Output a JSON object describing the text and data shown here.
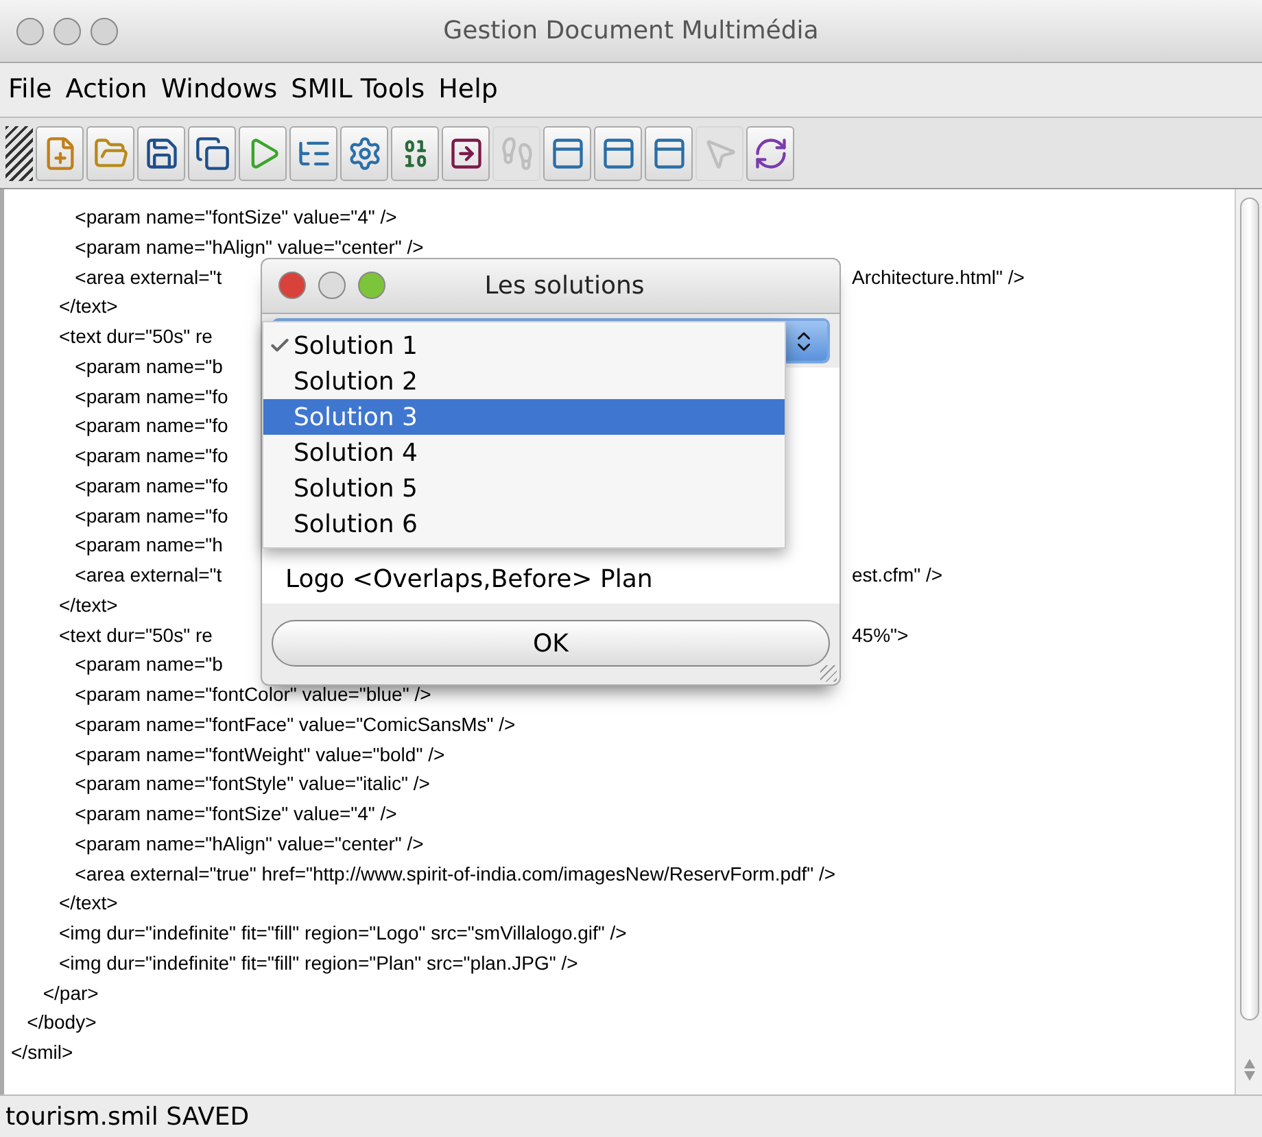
{
  "window": {
    "title": "Gestion Document Multimédia"
  },
  "menu": [
    "File",
    "Action",
    "Windows",
    "SMIL Tools",
    "Help"
  ],
  "toolbar": [
    {
      "kind": "new",
      "disabled": false
    },
    {
      "kind": "open",
      "disabled": false
    },
    {
      "kind": "save",
      "disabled": false
    },
    {
      "kind": "saveall",
      "disabled": false
    },
    {
      "kind": "play",
      "disabled": false
    },
    {
      "kind": "tree",
      "disabled": false
    },
    {
      "kind": "gear",
      "disabled": false
    },
    {
      "kind": "binary",
      "disabled": false
    },
    {
      "kind": "export",
      "disabled": false
    },
    {
      "kind": "run",
      "disabled": true
    },
    {
      "kind": "panel",
      "disabled": false
    },
    {
      "kind": "panel",
      "disabled": false
    },
    {
      "kind": "panel",
      "disabled": false
    },
    {
      "kind": "cursor",
      "disabled": true
    },
    {
      "kind": "refresh",
      "disabled": false
    }
  ],
  "editor": {
    "lines": [
      {
        "left": "            <param name=\"fontSize\" value=\"4\" />"
      },
      {
        "left": "            <param name=\"hAlign\" value=\"center\" />"
      },
      {
        "left": "            <area external=\"t",
        "right": "Architecture.html\" />"
      },
      {
        "left": "         </text>"
      },
      {
        "left": "         <text dur=\"50s\" re"
      },
      {
        "left": "            <param name=\"b"
      },
      {
        "left": "            <param name=\"fo"
      },
      {
        "left": "            <param name=\"fo"
      },
      {
        "left": "            <param name=\"fo"
      },
      {
        "left": "            <param name=\"fo"
      },
      {
        "left": "            <param name=\"fo"
      },
      {
        "left": "            <param name=\"h"
      },
      {
        "left": "            <area external=\"t",
        "right": "est.cfm\" />"
      },
      {
        "left": "         </text>"
      },
      {
        "left": "         <text dur=\"50s\" re",
        "right": "45%\">"
      },
      {
        "left": "            <param name=\"b"
      },
      {
        "left": "            <param name=\"fontColor\" value=\"blue\" />"
      },
      {
        "left": "            <param name=\"fontFace\" value=\"ComicSansMs\" />"
      },
      {
        "left": "            <param name=\"fontWeight\" value=\"bold\" />"
      },
      {
        "left": "            <param name=\"fontStyle\" value=\"italic\" />"
      },
      {
        "left": "            <param name=\"fontSize\" value=\"4\" />"
      },
      {
        "left": "            <param name=\"hAlign\" value=\"center\" />"
      },
      {
        "left": "            <area external=\"true\" href=\"http://www.spirit-of-india.com/imagesNew/ReservForm.pdf\" />"
      },
      {
        "left": "         </text>"
      },
      {
        "left": "         <img dur=\"indefinite\" fit=\"fill\" region=\"Logo\" src=\"smVillalogo.gif\" />"
      },
      {
        "left": "         <img dur=\"indefinite\" fit=\"fill\" region=\"Plan\" src=\"plan.JPG\" />"
      },
      {
        "left": "      </par>"
      },
      {
        "left": "   </body>"
      },
      {
        "left": "</smil>"
      }
    ]
  },
  "dialog": {
    "title": "Les solutions",
    "options": [
      {
        "label": "Solution 1",
        "checked": true,
        "selected": false
      },
      {
        "label": "Solution 2",
        "checked": false,
        "selected": false
      },
      {
        "label": "Solution 3",
        "checked": false,
        "selected": true
      },
      {
        "label": "Solution 4",
        "checked": false,
        "selected": false
      },
      {
        "label": "Solution 5",
        "checked": false,
        "selected": false
      },
      {
        "label": "Solution 6",
        "checked": false,
        "selected": false
      }
    ],
    "result": "Logo <Overlaps,Before> Plan",
    "button": "OK"
  },
  "status_bar": "tourism.smil SAVED"
}
